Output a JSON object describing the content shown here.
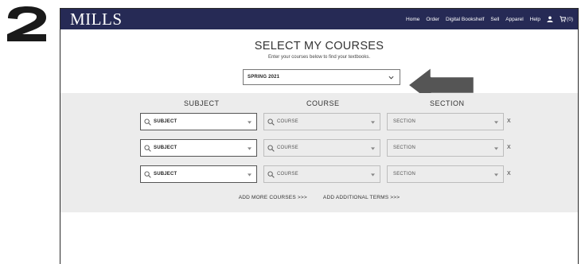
{
  "step": {
    "number": "2",
    "color": "#1a1a1a"
  },
  "navbar": {
    "logo": "MILLS",
    "background": "#262a55",
    "links": [
      "Home",
      "Order",
      "Digital Bookshelf",
      "Sell",
      "Apparel",
      "Help"
    ],
    "user_icon": "user-icon",
    "cart_icon": "cart-icon",
    "cart_label": "(0)"
  },
  "page": {
    "title": "SELECT MY COURSES",
    "subtitle": "Enter your courses below to find your textbooks.",
    "term_select": {
      "value": "SPRING 2021",
      "icon": "chevron-down-icon"
    }
  },
  "courses": {
    "headers": {
      "subject": "SUBJECT",
      "course": "COURSE",
      "section": "SECTION"
    },
    "band_color": "#ececec",
    "rows": [
      {
        "subject": "SUBJECT",
        "course": "COURSE",
        "section": "SECTION",
        "remove": "X"
      },
      {
        "subject": "SUBJECT",
        "course": "COURSE",
        "section": "SECTION",
        "remove": "X"
      },
      {
        "subject": "SUBJECT",
        "course": "COURSE",
        "section": "SECTION",
        "remove": "X"
      }
    ],
    "add_more": "ADD MORE COURSES >>>",
    "add_terms": "ADD ADDITIONAL TERMS >>>"
  }
}
